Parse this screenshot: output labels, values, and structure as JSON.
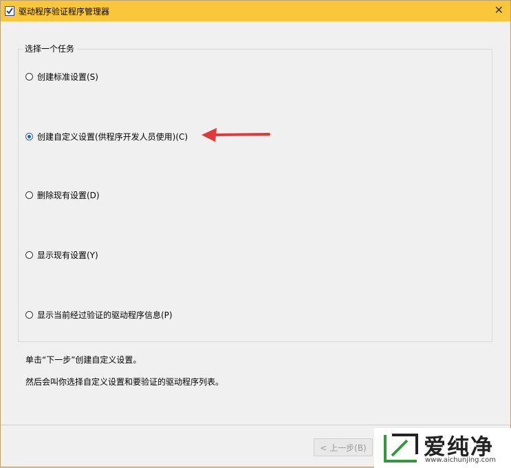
{
  "window": {
    "title": "驱动程序验证程序管理器",
    "close_glyph": "✕"
  },
  "task_group": {
    "title": "选择一个任务",
    "options": [
      {
        "label": "创建标准设置(S)",
        "checked": false
      },
      {
        "label": "创建自定义设置(供程序开发人员使用)(C)",
        "checked": true
      },
      {
        "label": "删除现有设置(D)",
        "checked": false
      },
      {
        "label": "显示现有设置(Y)",
        "checked": false
      },
      {
        "label": "显示当前经过验证的驱动程序信息(P)",
        "checked": false
      }
    ]
  },
  "info": {
    "line1": "单击“下一步”创建自定义设置。",
    "line2": "然后会叫你选择自定义设置和要验证的驱动程序列表。"
  },
  "buttons": {
    "back": "< 上一步(B)"
  },
  "watermark": {
    "brand": "爱纯净",
    "url": "www.aichunjing.com"
  },
  "colors": {
    "titlebar": "#fbc73a",
    "arrow": "#e0393a",
    "radio_selected": "#1a5fb4"
  }
}
